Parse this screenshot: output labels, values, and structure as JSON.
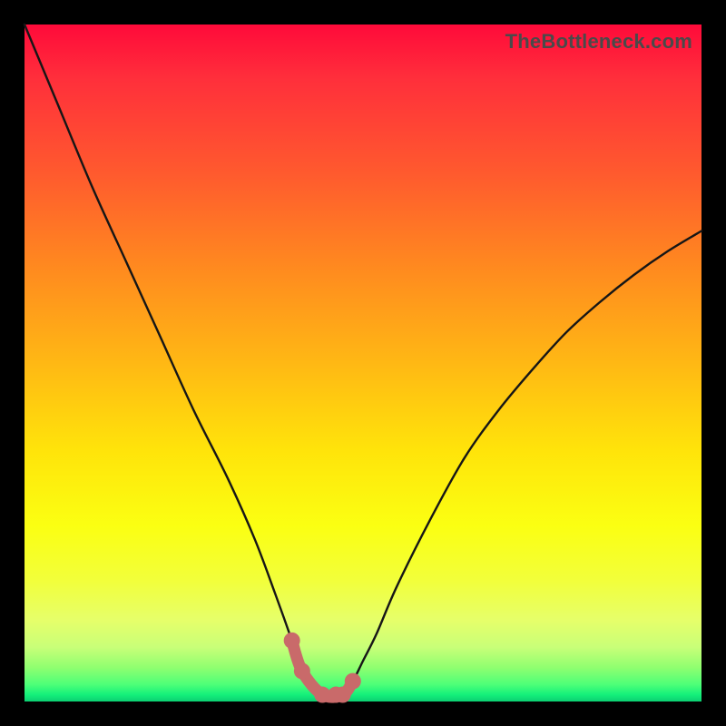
{
  "watermark": "TheBottleneck.com",
  "colors": {
    "frame": "#000000",
    "curve_stroke": "#161616",
    "highlight_stroke": "#c96a6a",
    "highlight_fill": "#c96a6a"
  },
  "chart_data": {
    "type": "line",
    "title": "",
    "xlabel": "",
    "ylabel": "",
    "xlim": [
      0,
      100
    ],
    "ylim": [
      0,
      100
    ],
    "grid": false,
    "legend": false,
    "series": [
      {
        "name": "bottleneck-curve",
        "x": [
          0,
          5,
          10,
          15,
          20,
          25,
          30,
          34,
          37,
          39.5,
          41,
          44,
          47,
          48.5,
          50,
          52,
          55,
          60,
          65,
          70,
          75,
          80,
          85,
          90,
          95,
          100
        ],
        "y": [
          100,
          88,
          76,
          65,
          54,
          43,
          33,
          24,
          16,
          9,
          4.5,
          1,
          1,
          3,
          6,
          10,
          17,
          27,
          36,
          43,
          49,
          54.5,
          59,
          63,
          66.5,
          69.5
        ]
      }
    ],
    "highlight": {
      "name": "valley-segment",
      "x": [
        39.5,
        41,
        44,
        47,
        48.5
      ],
      "y": [
        9,
        4.5,
        1,
        1,
        3
      ],
      "marker_x": [
        39.5,
        41,
        44,
        46,
        47,
        48.5
      ],
      "marker_y": [
        9,
        4.5,
        1,
        1,
        1,
        3
      ]
    }
  }
}
